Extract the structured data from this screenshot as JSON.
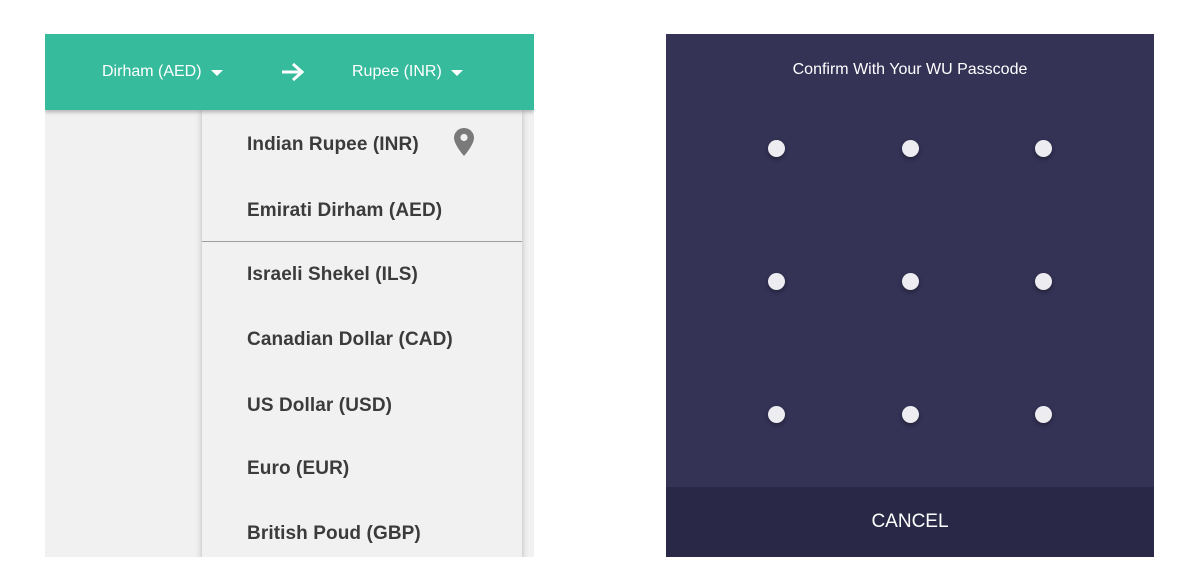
{
  "converter": {
    "from_currency": "Dirham (AED)",
    "to_currency": "Rupee (INR)",
    "dropdown_options": [
      "Indian Rupee (INR)",
      "Emirati Dirham (AED)",
      "Israeli Shekel (ILS)",
      "Canadian Dollar (CAD)",
      "US Dollar (USD)",
      "Euro (EUR)",
      "British Poud (GBP)"
    ],
    "icons": [
      "chevron-down-icon",
      "arrow-right-icon",
      "location-pin-icon"
    ],
    "colors": {
      "header": "#36bb9c",
      "panel": "#f1f1f1"
    }
  },
  "passcode": {
    "title": "Confirm With Your WU Passcode",
    "cancel_label": "CANCEL",
    "grid_size": "3x3",
    "colors": {
      "background": "#343255",
      "cancel_bar": "#292847",
      "dot": "#ececf1"
    }
  }
}
